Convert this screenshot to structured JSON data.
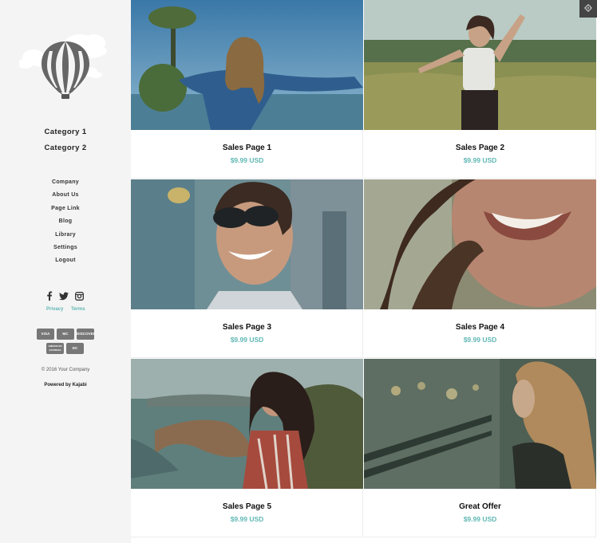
{
  "sidebar": {
    "categories": [
      {
        "label": "Category 1"
      },
      {
        "label": "Category 2"
      }
    ],
    "links": [
      {
        "label": "Company"
      },
      {
        "label": "About Us"
      },
      {
        "label": "Page Link"
      },
      {
        "label": "Blog"
      },
      {
        "label": "Library"
      },
      {
        "label": "Settings"
      },
      {
        "label": "Logout"
      }
    ],
    "social_icons": [
      "facebook-icon",
      "twitter-icon",
      "instagram-icon"
    ],
    "privacy_label": "Privacy",
    "terms_label": "Terms",
    "payment_cards": [
      {
        "label": "VISA"
      },
      {
        "label": "MC"
      },
      {
        "label": "DISCOVER"
      },
      {
        "label": "AMERICAN EXPRESS"
      },
      {
        "label": "DC"
      }
    ],
    "copyright": "© 2016 Your Company",
    "powered_by": "Powered by Kajabi"
  },
  "products": [
    {
      "title": "Sales Page 1",
      "price": "$9.99 USD"
    },
    {
      "title": "Sales Page 2",
      "price": "$9.99 USD"
    },
    {
      "title": "Sales Page 3",
      "price": "$9.99 USD"
    },
    {
      "title": "Sales Page 4",
      "price": "$9.99 USD"
    },
    {
      "title": "Sales Page 5",
      "price": "$9.99 USD"
    },
    {
      "title": "Great Offer",
      "price": "$9.99 USD"
    }
  ],
  "colors": {
    "accent": "#5fb7b4",
    "sidebar_bg": "#f4f4f4",
    "settings_button": "#444444"
  }
}
